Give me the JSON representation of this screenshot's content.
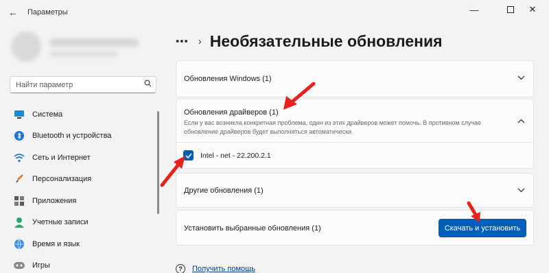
{
  "window": {
    "title": "Параметры",
    "back_icon": "arrow-left-icon",
    "controls": [
      "minimize-icon",
      "maximize-icon",
      "close-icon"
    ]
  },
  "sidebar": {
    "search": {
      "placeholder": "Найти параметр",
      "value": ""
    },
    "items": [
      {
        "label": "Система",
        "icon": "monitor-icon"
      },
      {
        "label": "Bluetooth и устройства",
        "icon": "bluetooth-icon"
      },
      {
        "label": "Сеть и Интернет",
        "icon": "wifi-icon"
      },
      {
        "label": "Персонализация",
        "icon": "brush-icon"
      },
      {
        "label": "Приложения",
        "icon": "apps-icon"
      },
      {
        "label": "Учетные записи",
        "icon": "user-icon"
      },
      {
        "label": "Время и язык",
        "icon": "globe-icon"
      },
      {
        "label": "Игры",
        "icon": "gamepad-icon"
      }
    ]
  },
  "header": {
    "more": "•••",
    "separator": "›",
    "title": "Необязательные обновления"
  },
  "sections": {
    "windows": {
      "title": "Обновления Windows (1)"
    },
    "drivers": {
      "title": "Обновления драйверов (1)",
      "description": "Если у вас возникла конкретная проблема, один из этих драйверов может помочь. В противном случае обновление драйверов будет выполняться автоматически.",
      "items": [
        {
          "label": "Intel - net - 22.200.2.1",
          "checked": true
        }
      ]
    },
    "other": {
      "title": "Другие обновления (1)"
    }
  },
  "install": {
    "label": "Установить выбранные обновления (1)",
    "button": "Скачать и установить"
  },
  "help": {
    "label": "Получить помощь"
  },
  "colors": {
    "accent": "#005fb8",
    "annotation": "#e8211b"
  }
}
